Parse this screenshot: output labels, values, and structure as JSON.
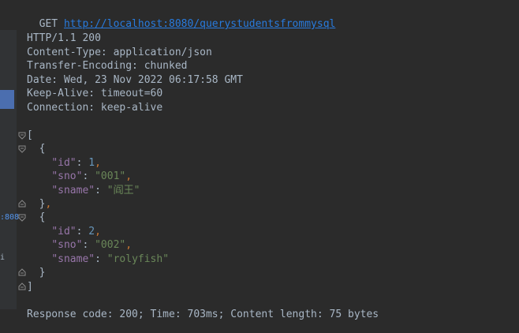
{
  "request": {
    "method": "GET",
    "url": "http://localhost:8080/querystudentsfrommysql"
  },
  "headers": [
    "HTTP/1.1 200",
    "Content-Type: application/json",
    "Transfer-Encoding: chunked",
    "Date: Wed, 23 Nov 2022 06:17:58 GMT",
    "Keep-Alive: timeout=60",
    "Connection: keep-alive"
  ],
  "json": {
    "open_bracket": "[",
    "close_bracket": "]",
    "open_brace": "{",
    "close_brace": "}",
    "keys": {
      "id": "\"id\"",
      "sno": "\"sno\"",
      "sname": "\"sname\""
    },
    "records": [
      {
        "id": "1",
        "sno": "\"001\"",
        "sname": "\"阎王\""
      },
      {
        "id": "2",
        "sno": "\"002\"",
        "sname": "\"rolyfish\""
      }
    ]
  },
  "footer": "Response code: 200; Time: 703ms; Content length: 75 bytes",
  "side_strip": {
    "port_fragment": ":808",
    "marker": "i"
  }
}
